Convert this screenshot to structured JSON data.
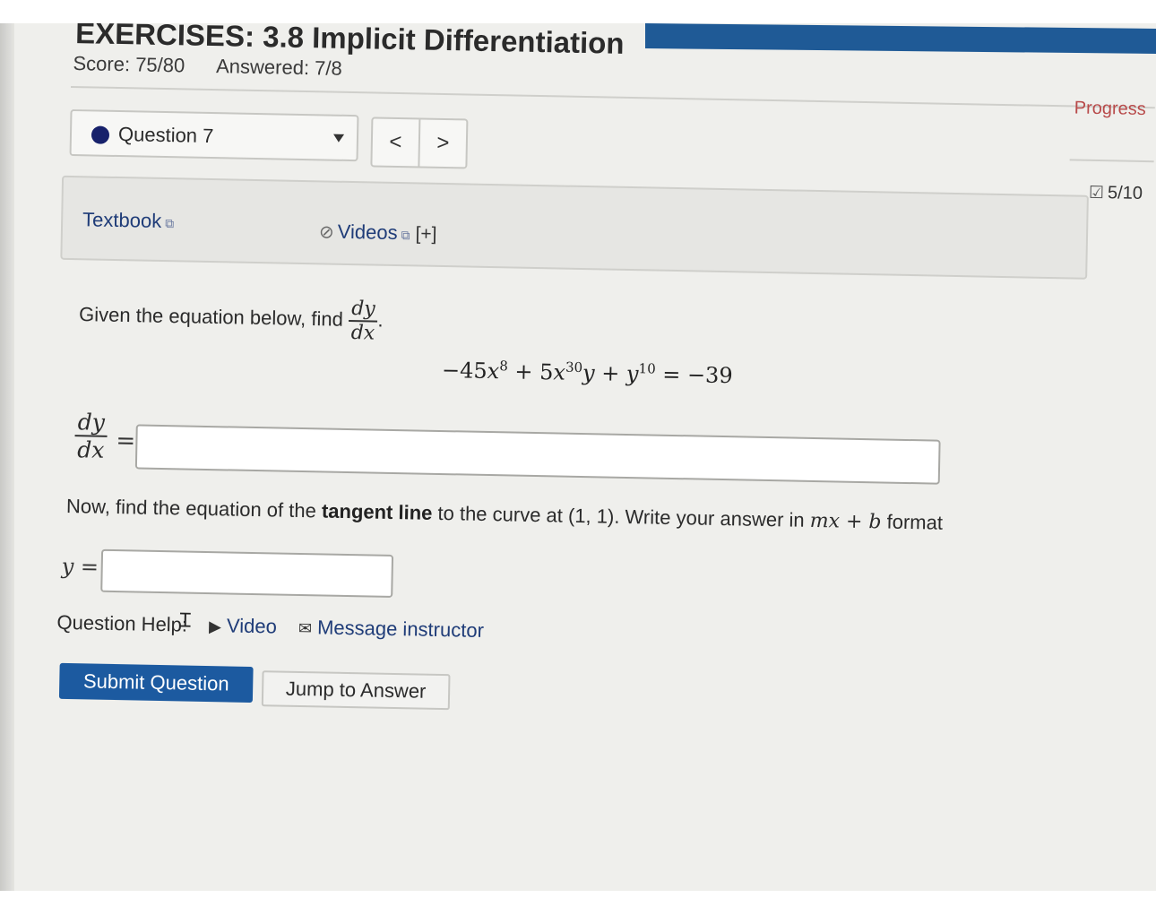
{
  "header": {
    "title": "EXERCISES: 3.8 Implicit Differentiation",
    "score": "Score: 75/80",
    "answered": "Answered: 7/8"
  },
  "question_nav": {
    "selected": "Question 7",
    "prev_label": "<",
    "next_label": ">"
  },
  "resources": {
    "textbook": "Textbook",
    "videos": "Videos",
    "expand": "[+]"
  },
  "problem": {
    "prompt": "Given the equation below, find",
    "frac_num": "dy",
    "frac_den": "dx",
    "eq_part1": "−45",
    "eq_x": "x",
    "eq_exp1": "8",
    "eq_part2": " + 5",
    "eq_x2": "x",
    "eq_exp2": "30",
    "eq_y": "y",
    "eq_plus": " + ",
    "eq_y2": "y",
    "eq_exp3": "10",
    "eq_rhs": " = −39",
    "answer_label_num": "dy",
    "answer_label_den": "dx",
    "equals": "=",
    "tangent_pre": "Now, find the equation of the ",
    "tangent_bold": "tangent line",
    "tangent_post": " to the curve at (1, 1). Write your answer in ",
    "tangent_form": "mx + b",
    "tangent_end": " format",
    "y_label": "y ="
  },
  "help": {
    "label": "Question Help:",
    "video": "Video",
    "message": "Message instructor"
  },
  "actions": {
    "submit": "Submit Question",
    "jump": "Jump to Answer"
  },
  "sidebar": {
    "progress": "Progress",
    "count": "5/10"
  },
  "colors": {
    "accent": "#1c5aa0",
    "link": "#1f3c78",
    "progress": "#b84a4a"
  }
}
